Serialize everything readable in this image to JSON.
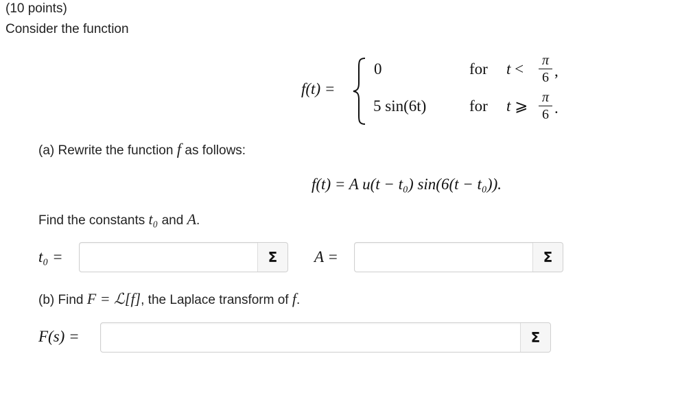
{
  "problem": {
    "points": "(10 points)",
    "intro": "Consider the function"
  },
  "definition": {
    "lhs": "f(t) =",
    "case1_value": "0",
    "case2_value": "5 sin(6t)",
    "case1_for": "for",
    "case2_for": "for",
    "case1_var": "t",
    "case1_rel": "<",
    "case2_var": "t",
    "case2_rel": "⩾",
    "frac_num": "π",
    "frac_den": "6",
    "case1_punct": ",",
    "case2_punct": "."
  },
  "part_a": {
    "prompt_prefix": "(a) Rewrite the function",
    "prompt_var": "f",
    "prompt_suffix": "as follows:",
    "rewritten": "f(t) = A u(t − t₀) sin(6(t − t₀)).",
    "find_prefix": "Find the constants",
    "find_t0": "t₀",
    "find_and": "and",
    "find_A": "A",
    "find_period": ".",
    "t0_label": "t₀ =",
    "A_label": "A =",
    "t0_value": "",
    "A_value": ""
  },
  "part_b": {
    "prompt_prefix": "(b) Find",
    "prompt_math": "F = ℒ[f]",
    "prompt_suffix": ", the Laplace transform of",
    "prompt_var": "f",
    "prompt_period": ".",
    "F_label": "F(s) =",
    "F_value": ""
  },
  "buttons": {
    "sigma_symbol": "Σ",
    "sigma_icon": "sigma-icon"
  }
}
